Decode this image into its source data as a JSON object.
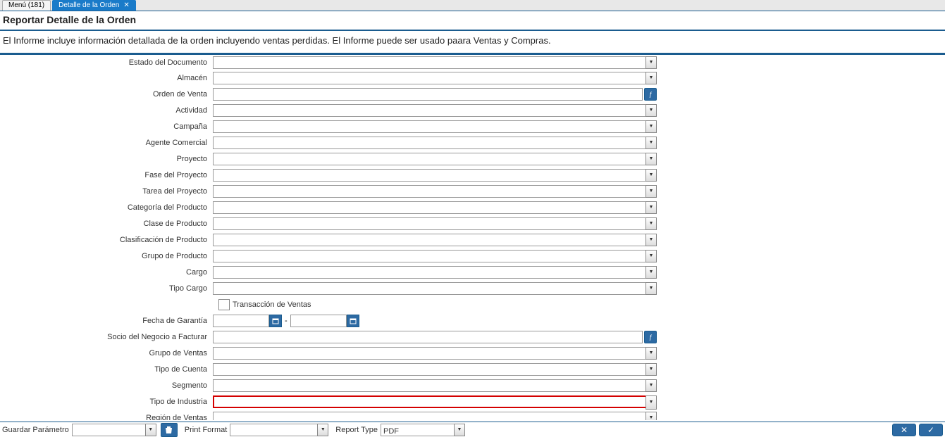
{
  "tabs": [
    {
      "label": "Menú (181)",
      "active": false
    },
    {
      "label": "Detalle de la Orden",
      "active": true
    }
  ],
  "header": {
    "title": "Reportar Detalle de la Orden",
    "description": "El Informe incluye información detallada de la orden incluyendo ventas perdidas. El Informe puede ser usado paara Ventas y Compras."
  },
  "fields": {
    "estado_documento": {
      "label": "Estado del Documento",
      "value": ""
    },
    "almacen": {
      "label": "Almacén",
      "value": ""
    },
    "orden_venta": {
      "label": "Orden de Venta",
      "value": ""
    },
    "actividad": {
      "label": "Actividad",
      "value": ""
    },
    "campana": {
      "label": "Campaña",
      "value": ""
    },
    "agente_comercial": {
      "label": "Agente Comercial",
      "value": ""
    },
    "proyecto": {
      "label": "Proyecto",
      "value": ""
    },
    "fase_proyecto": {
      "label": "Fase del Proyecto",
      "value": ""
    },
    "tarea_proyecto": {
      "label": "Tarea del Proyecto",
      "value": ""
    },
    "categoria_producto": {
      "label": "Categoría del Producto",
      "value": ""
    },
    "clase_producto": {
      "label": "Clase de Producto",
      "value": ""
    },
    "clasificacion_producto": {
      "label": "Clasificación de Producto",
      "value": ""
    },
    "grupo_producto": {
      "label": "Grupo de Producto",
      "value": ""
    },
    "cargo": {
      "label": "Cargo",
      "value": ""
    },
    "tipo_cargo": {
      "label": "Tipo Cargo",
      "value": ""
    },
    "transaccion_ventas": {
      "label": "Transacción de Ventas",
      "checked": false
    },
    "fecha_garantia": {
      "label": "Fecha de Garantía",
      "from": "",
      "to": ""
    },
    "socio_facturar": {
      "label": "Socio del Negocio a Facturar",
      "value": ""
    },
    "grupo_ventas": {
      "label": "Grupo de Ventas",
      "value": ""
    },
    "tipo_cuenta": {
      "label": "Tipo de Cuenta",
      "value": ""
    },
    "segmento": {
      "label": "Segmento",
      "value": ""
    },
    "tipo_industria": {
      "label": "Tipo de Industria",
      "value": ""
    },
    "region_ventas": {
      "label": "Región de Ventas",
      "value": ""
    }
  },
  "bottom": {
    "guardar_parametro": {
      "label": "Guardar Parámetro",
      "value": ""
    },
    "print_format": {
      "label": "Print Format",
      "value": ""
    },
    "report_type": {
      "label": "Report Type",
      "value": "PDF"
    }
  }
}
